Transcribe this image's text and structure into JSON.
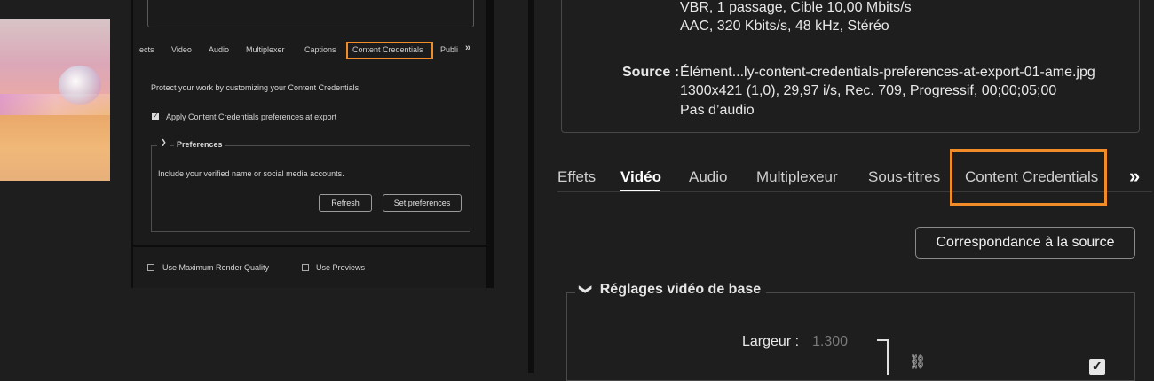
{
  "left_panel": {
    "tabs": [
      "ects",
      "Video",
      "Audio",
      "Multiplexer",
      "Captions",
      "Content Credentials",
      "Publi"
    ],
    "more_glyph": "»",
    "description": "Protect your work by customizing your Content Credentials.",
    "apply_checkbox": {
      "label": "Apply Content Credentials preferences at export",
      "checked": true
    },
    "preferences": {
      "title": "Preferences",
      "text": "Include your verified name or social media accounts.",
      "refresh_label": "Refresh",
      "set_preferences_label": "Set preferences"
    },
    "bottom_options": [
      {
        "label": "Use Maximum Render Quality",
        "checked": false
      },
      {
        "label": "Use Previews",
        "checked": false
      }
    ]
  },
  "right_panel": {
    "summary": {
      "video_line": "VBR, 1 passage, Cible 10,00  Mbits/s",
      "audio_line": "AAC, 320  Kbits/s, 48 kHz, Stéréo",
      "source_label": "Source :",
      "source_lines": [
        "Élément...ly-content-credentials-preferences-at-export-01-ame.jpg",
        "1300x421 (1,0), 29,97 i/s, Rec. 709, Progressif, 00;00;05;00",
        "Pas d’audio"
      ]
    },
    "tabs": [
      "Effets",
      "Vidéo",
      "Audio",
      "Multiplexeur",
      "Sous-titres",
      "Content Credentials"
    ],
    "active_tab": "Vidéo",
    "more_glyph": "»",
    "match_source_button": "Correspondance à la source",
    "basic_video_section": {
      "title": "Réglages vidéo de base",
      "width_label": "Largeur :",
      "width_value": "1.300",
      "checkbox_checked": true
    }
  },
  "colors": {
    "highlight": "#f28c28",
    "background": "#1e1e1e"
  }
}
